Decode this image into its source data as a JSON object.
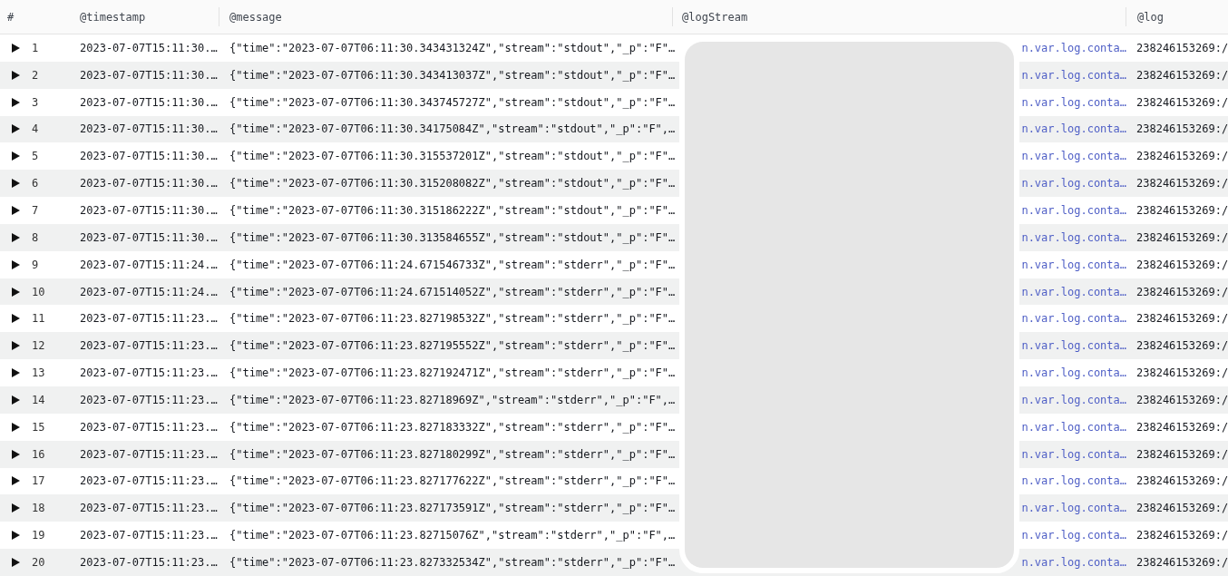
{
  "columns": [
    "#",
    "@timestamp",
    "@message",
    "@logStream",
    "@log"
  ],
  "rows": [
    {
      "number": "1",
      "expanded": false,
      "timestamp": "2023-07-07T15:11:30.…",
      "message": "{\"time\":\"2023-07-07T06:11:30.343431324Z\",\"stream\":\"stdout\",\"_p\":\"F\"…",
      "log_stream": "n.var.log.conta…",
      "log": "238246153269:/"
    },
    {
      "number": "2",
      "expanded": false,
      "timestamp": "2023-07-07T15:11:30.…",
      "message": "{\"time\":\"2023-07-07T06:11:30.343413037Z\",\"stream\":\"stdout\",\"_p\":\"F\"…",
      "log_stream": "n.var.log.conta…",
      "log": "238246153269:/"
    },
    {
      "number": "3",
      "expanded": false,
      "timestamp": "2023-07-07T15:11:30.…",
      "message": "{\"time\":\"2023-07-07T06:11:30.343745727Z\",\"stream\":\"stdout\",\"_p\":\"F\"…",
      "log_stream": "n.var.log.conta…",
      "log": "238246153269:/"
    },
    {
      "number": "4",
      "expanded": false,
      "timestamp": "2023-07-07T15:11:30.…",
      "message": "{\"time\":\"2023-07-07T06:11:30.34175084Z\",\"stream\":\"stdout\",\"_p\":\"F\",…",
      "log_stream": "n.var.log.conta…",
      "log": "238246153269:/"
    },
    {
      "number": "5",
      "expanded": false,
      "timestamp": "2023-07-07T15:11:30.…",
      "message": "{\"time\":\"2023-07-07T06:11:30.315537201Z\",\"stream\":\"stdout\",\"_p\":\"F\"…",
      "log_stream": "n.var.log.conta…",
      "log": "238246153269:/"
    },
    {
      "number": "6",
      "expanded": false,
      "timestamp": "2023-07-07T15:11:30.…",
      "message": "{\"time\":\"2023-07-07T06:11:30.315208082Z\",\"stream\":\"stdout\",\"_p\":\"F\"…",
      "log_stream": "n.var.log.conta…",
      "log": "238246153269:/"
    },
    {
      "number": "7",
      "expanded": false,
      "timestamp": "2023-07-07T15:11:30.…",
      "message": "{\"time\":\"2023-07-07T06:11:30.315186222Z\",\"stream\":\"stdout\",\"_p\":\"F\"…",
      "log_stream": "n.var.log.conta…",
      "log": "238246153269:/"
    },
    {
      "number": "8",
      "expanded": false,
      "timestamp": "2023-07-07T15:11:30.…",
      "message": "{\"time\":\"2023-07-07T06:11:30.313584655Z\",\"stream\":\"stdout\",\"_p\":\"F\"…",
      "log_stream": "n.var.log.conta…",
      "log": "238246153269:/"
    },
    {
      "number": "9",
      "expanded": false,
      "timestamp": "2023-07-07T15:11:24.…",
      "message": "{\"time\":\"2023-07-07T06:11:24.671546733Z\",\"stream\":\"stderr\",\"_p\":\"F\"…",
      "log_stream": "n.var.log.conta…",
      "log": "238246153269:/"
    },
    {
      "number": "10",
      "expanded": false,
      "timestamp": "2023-07-07T15:11:24.…",
      "message": "{\"time\":\"2023-07-07T06:11:24.671514052Z\",\"stream\":\"stderr\",\"_p\":\"F\"…",
      "log_stream": "n.var.log.conta…",
      "log": "238246153269:/"
    },
    {
      "number": "11",
      "expanded": false,
      "timestamp": "2023-07-07T15:11:23.…",
      "message": "{\"time\":\"2023-07-07T06:11:23.827198532Z\",\"stream\":\"stderr\",\"_p\":\"F\"…",
      "log_stream": "n.var.log.conta…",
      "log": "238246153269:/"
    },
    {
      "number": "12",
      "expanded": false,
      "timestamp": "2023-07-07T15:11:23.…",
      "message": "{\"time\":\"2023-07-07T06:11:23.827195552Z\",\"stream\":\"stderr\",\"_p\":\"F\"…",
      "log_stream": "n.var.log.conta…",
      "log": "238246153269:/"
    },
    {
      "number": "13",
      "expanded": false,
      "timestamp": "2023-07-07T15:11:23.…",
      "message": "{\"time\":\"2023-07-07T06:11:23.827192471Z\",\"stream\":\"stderr\",\"_p\":\"F\"…",
      "log_stream": "n.var.log.conta…",
      "log": "238246153269:/"
    },
    {
      "number": "14",
      "expanded": false,
      "timestamp": "2023-07-07T15:11:23.…",
      "message": "{\"time\":\"2023-07-07T06:11:23.82718969Z\",\"stream\":\"stderr\",\"_p\":\"F\",…",
      "log_stream": "n.var.log.conta…",
      "log": "238246153269:/"
    },
    {
      "number": "15",
      "expanded": false,
      "timestamp": "2023-07-07T15:11:23.…",
      "message": "{\"time\":\"2023-07-07T06:11:23.827183332Z\",\"stream\":\"stderr\",\"_p\":\"F\"…",
      "log_stream": "n.var.log.conta…",
      "log": "238246153269:/"
    },
    {
      "number": "16",
      "expanded": false,
      "timestamp": "2023-07-07T15:11:23.…",
      "message": "{\"time\":\"2023-07-07T06:11:23.827180299Z\",\"stream\":\"stderr\",\"_p\":\"F\"…",
      "log_stream": "n.var.log.conta…",
      "log": "238246153269:/"
    },
    {
      "number": "17",
      "expanded": false,
      "timestamp": "2023-07-07T15:11:23.…",
      "message": "{\"time\":\"2023-07-07T06:11:23.827177622Z\",\"stream\":\"stderr\",\"_p\":\"F\"…",
      "log_stream": "n.var.log.conta…",
      "log": "238246153269:/"
    },
    {
      "number": "18",
      "expanded": false,
      "timestamp": "2023-07-07T15:11:23.…",
      "message": "{\"time\":\"2023-07-07T06:11:23.827173591Z\",\"stream\":\"stderr\",\"_p\":\"F\"…",
      "log_stream": "n.var.log.conta…",
      "log": "238246153269:/"
    },
    {
      "number": "19",
      "expanded": false,
      "timestamp": "2023-07-07T15:11:23.…",
      "message": "{\"time\":\"2023-07-07T06:11:23.82715076Z\",\"stream\":\"stderr\",\"_p\":\"F\",…",
      "log_stream": "n.var.log.conta…",
      "log": "238246153269:/"
    },
    {
      "number": "20",
      "expanded": false,
      "timestamp": "2023-07-07T15:11:23.…",
      "message": "{\"time\":\"2023-07-07T06:11:23.827332534Z\",\"stream\":\"stderr\",\"_p\":\"F\"…",
      "log_stream": "n.var.log.conta…",
      "log": "238246153269:/"
    }
  ]
}
